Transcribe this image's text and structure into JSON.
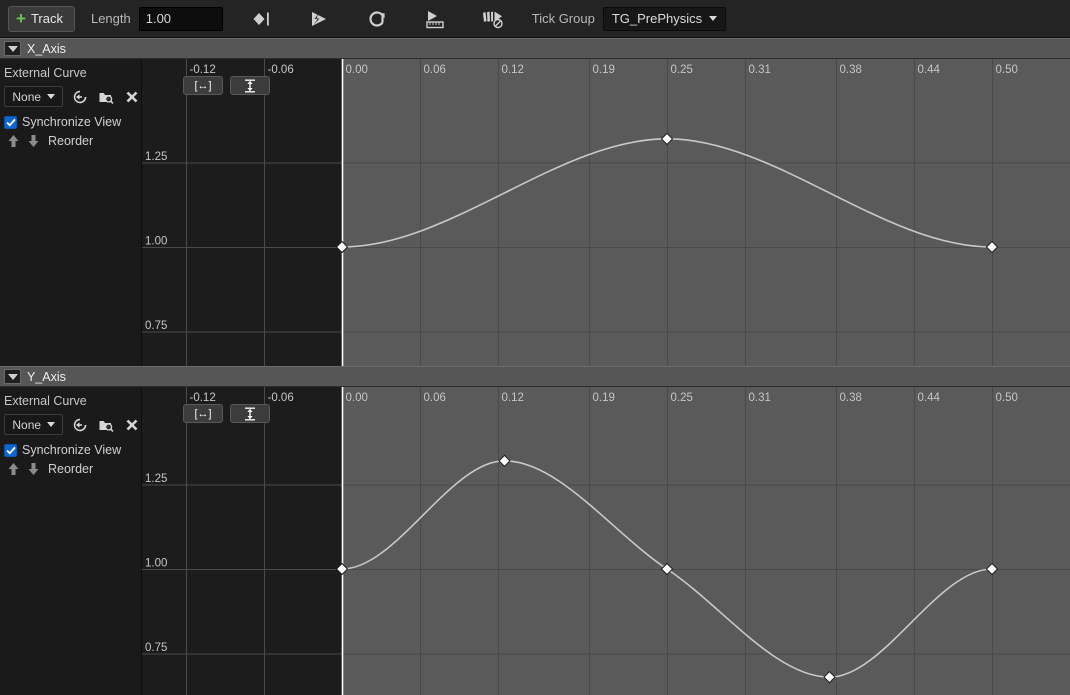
{
  "toolbar": {
    "add_track_label": "Track",
    "plus_glyph": "+",
    "length_label": "Length",
    "length_value": "1.00",
    "icons": [
      {
        "name": "add-keyframe-icon",
        "title": "Add Key"
      },
      {
        "name": "play-lightning-icon",
        "title": "Auto Play"
      },
      {
        "name": "loop-icon",
        "title": "Loop"
      },
      {
        "name": "play-ruler-icon",
        "title": "Use Last Keyframe"
      },
      {
        "name": "ignore-time-dilation-icon",
        "title": "Ignore Time Dilation"
      }
    ],
    "tick_group_label": "Tick Group",
    "tick_group_value": "TG_PrePhysics"
  },
  "panel_common": {
    "external_curve_label": "External Curve",
    "curve_asset_value": "None",
    "use_selected_icon": "use-selected-asset-icon",
    "browse_icon": "browse-asset-icon",
    "clear_icon": "clear-asset-icon",
    "synchronize_view_label": "Synchronize View",
    "synchronize_view_checked": true,
    "reorder_label": "Reorder",
    "reorder_up_icon": "arrow-up-icon",
    "reorder_down_icon": "arrow-down-icon",
    "fit_horizontal_label": "[↔]",
    "fit_vertical_label": "↕"
  },
  "colors": {
    "toolbar_bg": "#242424",
    "section_header_bg": "#565656",
    "graph_bg": "#5a5a5a",
    "graph_bg_negative": "#1c1c1c",
    "grid_line": "#4a4a4a",
    "curve": "#c9c9c9",
    "key_fill": "#ffffff",
    "accent_green": "#6ec05a",
    "checkbox_blue": "#1166cc",
    "zero_line": "#ffffff"
  },
  "tracks": [
    {
      "name": "X_Axis",
      "expanded": true,
      "chart_data": {
        "type": "line",
        "title": "X_Axis",
        "xlabel": "",
        "ylabel": "",
        "xlim": [
          -0.155,
          0.535
        ],
        "ylim": [
          0.615,
          1.4
        ],
        "grid": true,
        "legend": "none",
        "x_ticks": [
          -0.12,
          -0.06,
          0.0,
          0.06,
          0.12,
          0.19,
          0.25,
          0.31,
          0.38,
          0.44,
          0.5
        ],
        "x_tick_labels": [
          "-0.12",
          "-0.06",
          "0.00",
          "0.06",
          "0.12",
          "0.19",
          "0.25",
          "0.31",
          "0.38",
          "0.44",
          "0.50"
        ],
        "y_ticks": [
          1.25,
          1.0,
          0.75
        ],
        "y_tick_labels": [
          "1.25",
          "1.00",
          "0.75"
        ],
        "series": [
          {
            "name": "X_Axis",
            "keys": [
              {
                "time": 0.0,
                "value": 1.0
              },
              {
                "time": 0.25,
                "value": 1.32
              },
              {
                "time": 0.5,
                "value": 1.0
              }
            ]
          }
        ]
      }
    },
    {
      "name": "Y_Axis",
      "expanded": true,
      "chart_data": {
        "type": "line",
        "title": "Y_Axis",
        "xlabel": "",
        "ylabel": "",
        "xlim": [
          -0.155,
          0.535
        ],
        "ylim": [
          0.615,
          1.4
        ],
        "grid": true,
        "legend": "none",
        "x_ticks": [
          -0.12,
          -0.06,
          0.0,
          0.06,
          0.12,
          0.19,
          0.25,
          0.31,
          0.38,
          0.44,
          0.5
        ],
        "x_tick_labels": [
          "-0.12",
          "-0.06",
          "0.00",
          "0.06",
          "0.12",
          "0.19",
          "0.25",
          "0.31",
          "0.38",
          "0.44",
          "0.50"
        ],
        "y_ticks": [
          1.25,
          1.0,
          0.75
        ],
        "y_tick_labels": [
          "1.25",
          "1.00",
          "0.75"
        ],
        "series": [
          {
            "name": "Y_Axis",
            "keys": [
              {
                "time": 0.0,
                "value": 1.0
              },
              {
                "time": 0.125,
                "value": 1.32
              },
              {
                "time": 0.25,
                "value": 1.0
              },
              {
                "time": 0.375,
                "value": 0.68
              },
              {
                "time": 0.5,
                "value": 1.0
              }
            ]
          }
        ]
      }
    }
  ]
}
